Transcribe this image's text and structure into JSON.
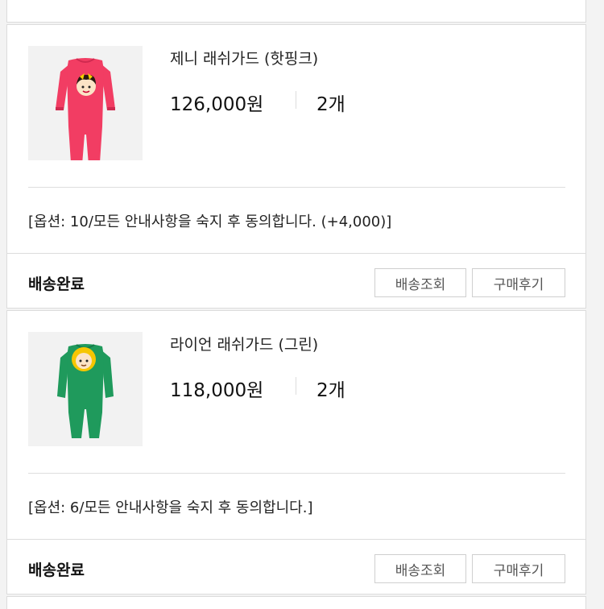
{
  "orders": [
    {
      "product_name": "제니 래쉬가드 (핫핑크)",
      "price": "126,000원",
      "quantity": "2개",
      "option": "[옵션: 10/모든 안내사항을 숙지 후 동의합니다. (+4,000)]",
      "status": "배송완료",
      "track_label": "배송조회",
      "review_label": "구매후기",
      "garment_color": "#f23d63"
    },
    {
      "product_name": "라이언 래쉬가드 (그린)",
      "price": "118,000원",
      "quantity": "2개",
      "option": "[옵션: 6/모든 안내사항을 숙지 후 동의합니다.]",
      "status": "배송완료",
      "track_label": "배송조회",
      "review_label": "구매후기",
      "garment_color": "#1f9a5c"
    }
  ]
}
